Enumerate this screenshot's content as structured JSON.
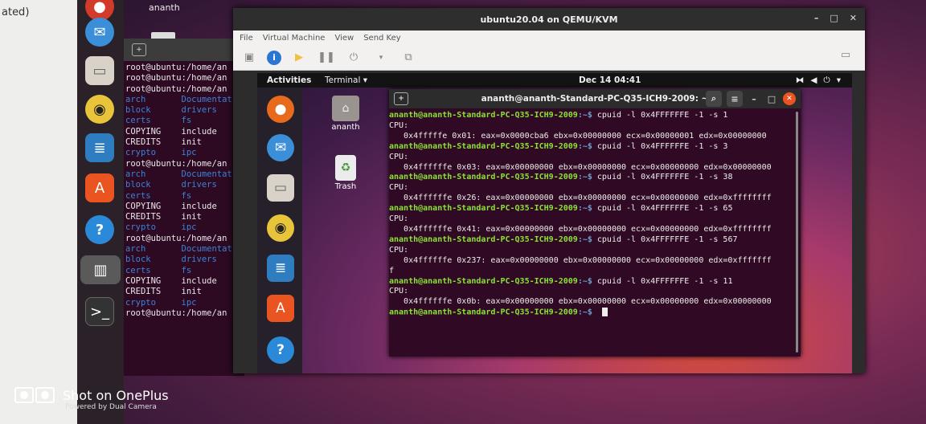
{
  "host": {
    "left_panel_text": "ated)",
    "user_label": "ananth",
    "root_terminal": {
      "lines": [
        {
          "kind": "white",
          "text": "root@ubuntu:/home/an"
        },
        {
          "kind": "white",
          "text": "root@ubuntu:/home/an"
        },
        {
          "kind": "white",
          "text": "root@ubuntu:/home/an"
        },
        {
          "kind": "dir",
          "text": "arch       Documentati"
        },
        {
          "kind": "dir",
          "text": "block      drivers"
        },
        {
          "kind": "dir",
          "text": "certs      fs"
        },
        {
          "kind": "mixed",
          "text": "COPYING    include"
        },
        {
          "kind": "mixed",
          "text": "CREDITS    init"
        },
        {
          "kind": "dir",
          "text": "crypto     ipc"
        },
        {
          "kind": "white",
          "text": "root@ubuntu:/home/an"
        },
        {
          "kind": "dir",
          "text": "arch       Documentati"
        },
        {
          "kind": "dir",
          "text": "block      drivers"
        },
        {
          "kind": "dir",
          "text": "certs      fs"
        },
        {
          "kind": "mixed",
          "text": "COPYING    include"
        },
        {
          "kind": "mixed",
          "text": "CREDITS    init"
        },
        {
          "kind": "dir",
          "text": "crypto     ipc"
        },
        {
          "kind": "white",
          "text": "root@ubuntu:/home/an"
        },
        {
          "kind": "dir",
          "text": "arch       Documentati"
        },
        {
          "kind": "dir",
          "text": "block      drivers"
        },
        {
          "kind": "dir",
          "text": "certs      fs"
        },
        {
          "kind": "mixed",
          "text": "COPYING    include"
        },
        {
          "kind": "mixed",
          "text": "CREDITS    init"
        },
        {
          "kind": "dir",
          "text": "crypto     ipc"
        },
        {
          "kind": "white",
          "text": "root@ubuntu:/home/an"
        }
      ]
    }
  },
  "vm": {
    "title": "ubuntu20.04 on QEMU/KVM",
    "menu": [
      "File",
      "Virtual Machine",
      "View",
      "Send Key"
    ]
  },
  "guest": {
    "activities": "Activities",
    "terminal_menu": "Terminal ▾",
    "clock": "Dec 14  04:41",
    "desktop_home_label": "ananth",
    "desktop_trash_label": "Trash",
    "terminal": {
      "title": "ananth@ananth-Standard-PC-Q35-ICH9-2009: ~",
      "prompt_user": "ananth@ananth-Standard-PC-Q35-ICH9-2009",
      "prompt_path": ":~$",
      "blocks": [
        {
          "cmd": " cpuid -l 0x4FFFFFFE -1 -s 1",
          "out": [
            "CPU:",
            "   0x4fffffe 0x01: eax=0x0000cba6 ebx=0x00000000 ecx=0x00000001 edx=0x00000000"
          ]
        },
        {
          "cmd": " cpuid -l 0x4FFFFFFE -1 -s 3",
          "out": [
            "CPU:",
            "   0x4ffffffe 0x03: eax=0x00000000 ebx=0x00000000 ecx=0x00000000 edx=0x00000000"
          ]
        },
        {
          "cmd": " cpuid -l 0x4FFFFFFE -1 -s 38",
          "out": [
            "CPU:",
            "   0x4ffffffe 0x26: eax=0x00000000 ebx=0x00000000 ecx=0x00000000 edx=0xffffffff"
          ]
        },
        {
          "cmd": " cpuid -l 0x4FFFFFFE -1 -s 65",
          "out": [
            "CPU:",
            "   0x4ffffffe 0x41: eax=0x00000000 ebx=0x00000000 ecx=0x00000000 edx=0xffffffff"
          ]
        },
        {
          "cmd": " cpuid -l 0x4FFFFFFE -1 -s 567",
          "out": [
            "CPU:",
            "   0x4ffffffe 0x237: eax=0x00000000 ebx=0x00000000 ecx=0x00000000 edx=0xfffffff",
            "f"
          ]
        },
        {
          "cmd": " cpuid -l 0x4FFFFFFE -1 -s 11",
          "out": [
            "CPU:",
            "   0x4ffffffe 0x0b: eax=0x00000000 ebx=0x00000000 ecx=0x00000000 edx=0x00000000"
          ]
        }
      ]
    }
  },
  "watermark": {
    "main": "Shot on OnePlus",
    "sub": "Powered by Dual Camera"
  }
}
